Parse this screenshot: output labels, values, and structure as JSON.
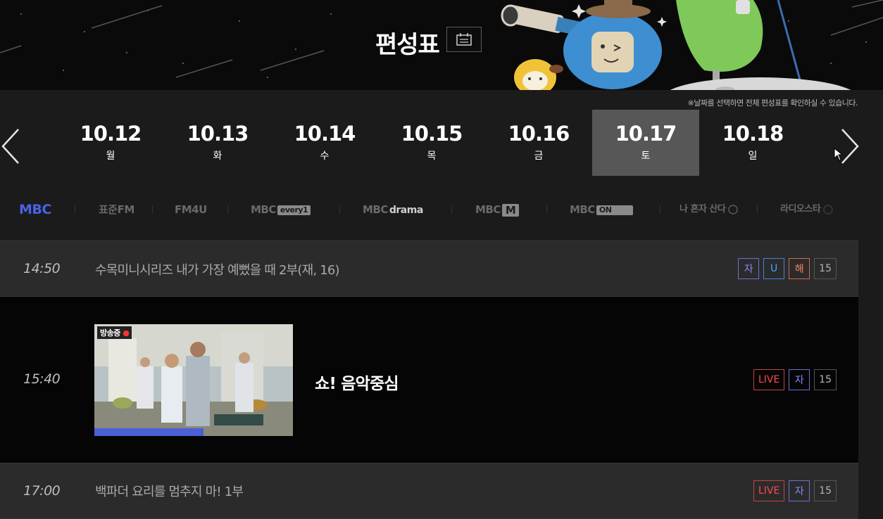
{
  "header": {
    "title": "편성표"
  },
  "dates": {
    "notice": "※날짜를 선택하면 전체 편성표를 확인하실 수 있습니다.",
    "items": [
      {
        "date": "10.12",
        "weekday": "월"
      },
      {
        "date": "10.13",
        "weekday": "화"
      },
      {
        "date": "10.14",
        "weekday": "수"
      },
      {
        "date": "10.15",
        "weekday": "목"
      },
      {
        "date": "10.16",
        "weekday": "금"
      },
      {
        "date": "10.17",
        "weekday": "토"
      },
      {
        "date": "10.18",
        "weekday": "일"
      }
    ],
    "selected": "10.17"
  },
  "channels": {
    "mbc": "MBC",
    "standard_fm": "표준FM",
    "fm4u": "FM4U",
    "every1": "MBC",
    "every1_suffix": "every1",
    "drama": "MBC",
    "drama_suffix": "drama",
    "m": "MBC",
    "m_suffix": "M",
    "on": "MBC",
    "on_suffix": "ON",
    "alone": "나 혼자 산다",
    "radiostar": "라디오스타"
  },
  "schedule": [
    {
      "time": "14:50",
      "title": "수목미니시리즈 내가 가장 예뻤을 때 2부(재, 16)",
      "badges": [
        "자",
        "U",
        "해",
        "15"
      ]
    },
    {
      "time": "15:40",
      "title": "쇼! 음악중심",
      "on_air_label": "방송중",
      "progress": 0.55,
      "badges": [
        "LIVE",
        "자",
        "15"
      ]
    },
    {
      "time": "17:00",
      "title": "백파더 요리를 멈추지 마! 1부",
      "badges": [
        "LIVE",
        "자",
        "15"
      ]
    }
  ],
  "colors": {
    "accent": "#4a62e6",
    "active_date_bg": "#575757",
    "live_red": "#ff4b4b"
  }
}
